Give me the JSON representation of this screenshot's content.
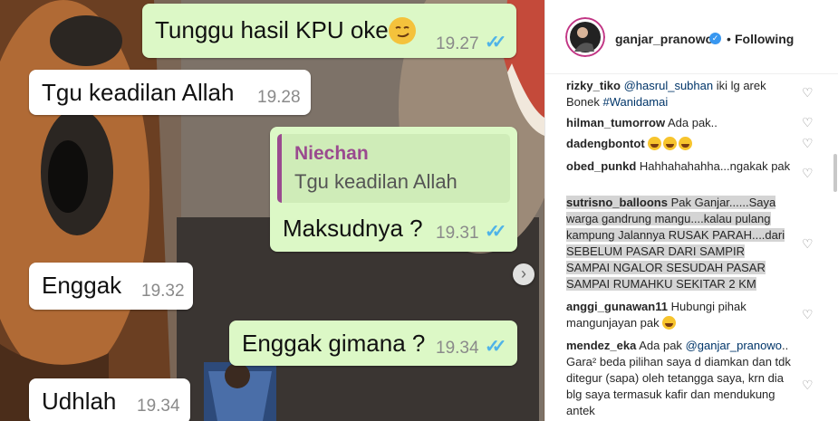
{
  "chat": {
    "messages": [
      {
        "text": "Tunggu hasil KPU oke",
        "time": "19.27",
        "direction": "out",
        "read": true
      },
      {
        "text": "Tgu keadilan Allah",
        "time": "19.28",
        "direction": "in"
      },
      {
        "quote_author": "Niechan",
        "quote_text": "Tgu keadilan Allah",
        "text": "Maksudnya ?",
        "time": "19.31",
        "direction": "out",
        "read": true
      },
      {
        "text": "Enggak",
        "time": "19.32",
        "direction": "in"
      },
      {
        "text": "Enggak gimana ?",
        "time": "19.34",
        "direction": "out",
        "read": true
      },
      {
        "text": "Udhlah",
        "time": "19.34",
        "direction": "in"
      }
    ],
    "emoji_icon": "smirk-emoji-icon",
    "read_icon": "double-check-icon",
    "next_icon": "chevron-right-icon"
  },
  "profile": {
    "username": "ganjar_pranowo",
    "dot": "•",
    "follow_status": "Following",
    "verified_icon": "verified-badge-icon"
  },
  "comments": [
    {
      "user": "rizky_tiko",
      "mention": "@hasrul_subhan",
      "text": " iki lg arek Bonek ",
      "hashtag": "#Wanidamai"
    },
    {
      "user": "hilman_tumorrow",
      "text": "Ada pak.."
    },
    {
      "user": "dadengbontot",
      "emoji_count": 3
    },
    {
      "user": "obed_punkd",
      "text": "Hahhahahahha...ngakak pak"
    },
    {
      "user": "sutrisno_balloons",
      "text": "Pak Ganjar......Saya warga gandrung mangu....kalau pulang kampung Jalannya RUSAK PARAH....dari SEBELUM PASAR DARI SAMPIR SAMPAI NGALOR SESUDAH PASAR SAMPAI RUMAHKU SEKITAR 2 KM"
    },
    {
      "user": "anggi_gunawan11",
      "text": "Hubungi pihak mangunjayan pak"
    },
    {
      "user": "mendez_eka",
      "text": "Ada pak",
      "mention": "@ganjar_pranowo",
      "text2": ".. Gara² beda pilihan saya d diamkan dan tdk ditegur (sapa) oleh tetangga saya, krn dia blg saya termasuk kafir dan mendukung antek"
    }
  ],
  "colors": {
    "outgoing_bubble": "#dcf8c6",
    "incoming_bubble": "#ffffff",
    "read_ticks": "#4fb3e8",
    "quote_accent": "#9a4a8f",
    "verified": "#3897f0"
  },
  "icons": {
    "heart": "♡",
    "arrow": "›",
    "check": "✓"
  }
}
